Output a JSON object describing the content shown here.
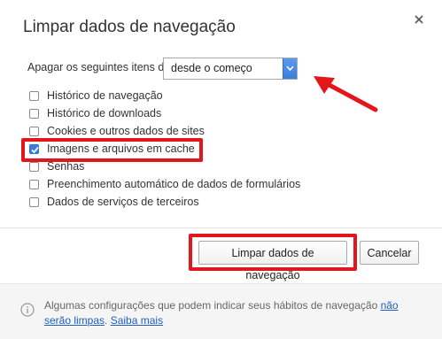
{
  "dialog": {
    "title": "Limpar dados de navegação",
    "clear_label": "Apagar os seguintes itens de:",
    "time_range_selected": "desde o começo"
  },
  "options": [
    {
      "label": "Histórico de navegação",
      "checked": false
    },
    {
      "label": "Histórico de downloads",
      "checked": false
    },
    {
      "label": "Cookies e outros dados de sites",
      "checked": false
    },
    {
      "label": "Imagens e arquivos em cache",
      "checked": true
    },
    {
      "label": "Senhas",
      "checked": false
    },
    {
      "label": "Preenchimento automático de dados de formulários",
      "checked": false
    },
    {
      "label": "Dados de serviços de terceiros",
      "checked": false
    }
  ],
  "buttons": {
    "clear": "Limpar dados de navegação",
    "cancel": "Cancelar"
  },
  "footer": {
    "text_before_link": "Algumas configurações que podem indicar seus hábitos de navegação ",
    "link_not_cleared": "não serão limpas",
    "separator": ". ",
    "link_learn_more": "Saiba mais"
  },
  "colors": {
    "annotation_red": "#e3161b",
    "checkbox_blue": "#3a7fe0",
    "link_blue": "#1f5fbf"
  }
}
